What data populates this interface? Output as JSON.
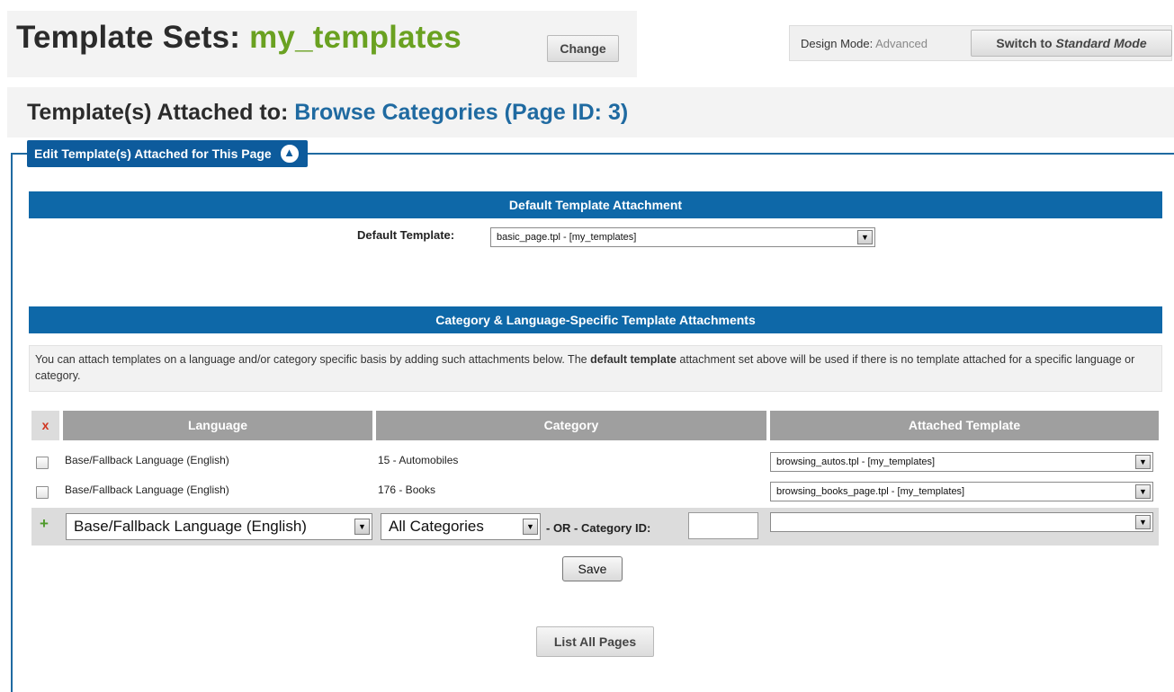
{
  "header": {
    "title_prefix": "Template Sets:",
    "template_set": "my_templates",
    "change_label": "Change",
    "design_mode_label": "Design Mode:",
    "design_mode_value": "Advanced",
    "switch_prefix": "Switch to ",
    "switch_mode": "Standard Mode"
  },
  "page": {
    "attached_prefix": "Template(s) Attached to:",
    "page_name": "Browse Categories (Page ID: 3)"
  },
  "fieldset": {
    "legend": "Edit Template(s) Attached for This Page",
    "collapse_icon": "▲"
  },
  "default_section": {
    "heading": "Default Template Attachment",
    "label": "Default Template:",
    "selected": "basic_page.tpl - [my_templates]"
  },
  "specific_section": {
    "heading": "Category & Language-Specific Template Attachments",
    "notice_part1": "You can attach templates on a language and/or category specific basis by adding such attachments below. The ",
    "notice_bold": "default template",
    "notice_part2": " attachment set above will be used if there is no template attached for a specific language or category."
  },
  "table": {
    "delete_header": "x",
    "columns": [
      "Language",
      "Category",
      "Attached Template"
    ],
    "rows": [
      {
        "language": "Base/Fallback Language (English)",
        "category": "15 - Automobiles",
        "template": "browsing_autos.tpl - [my_templates]"
      },
      {
        "language": "Base/Fallback Language (English)",
        "category": "176 - Books",
        "template": "browsing_books_page.tpl - [my_templates]"
      }
    ],
    "add_row": {
      "plus": "+",
      "language": "Base/Fallback Language (English)",
      "category": "All Categories",
      "or_label": "- OR - Category ID:",
      "category_id": "",
      "template": ""
    }
  },
  "buttons": {
    "save": "Save",
    "list_all": "List All Pages"
  },
  "colors": {
    "accent_blue": "#0e68a8",
    "title_green": "#6aa121",
    "header_gray": "#9f9f9f"
  }
}
